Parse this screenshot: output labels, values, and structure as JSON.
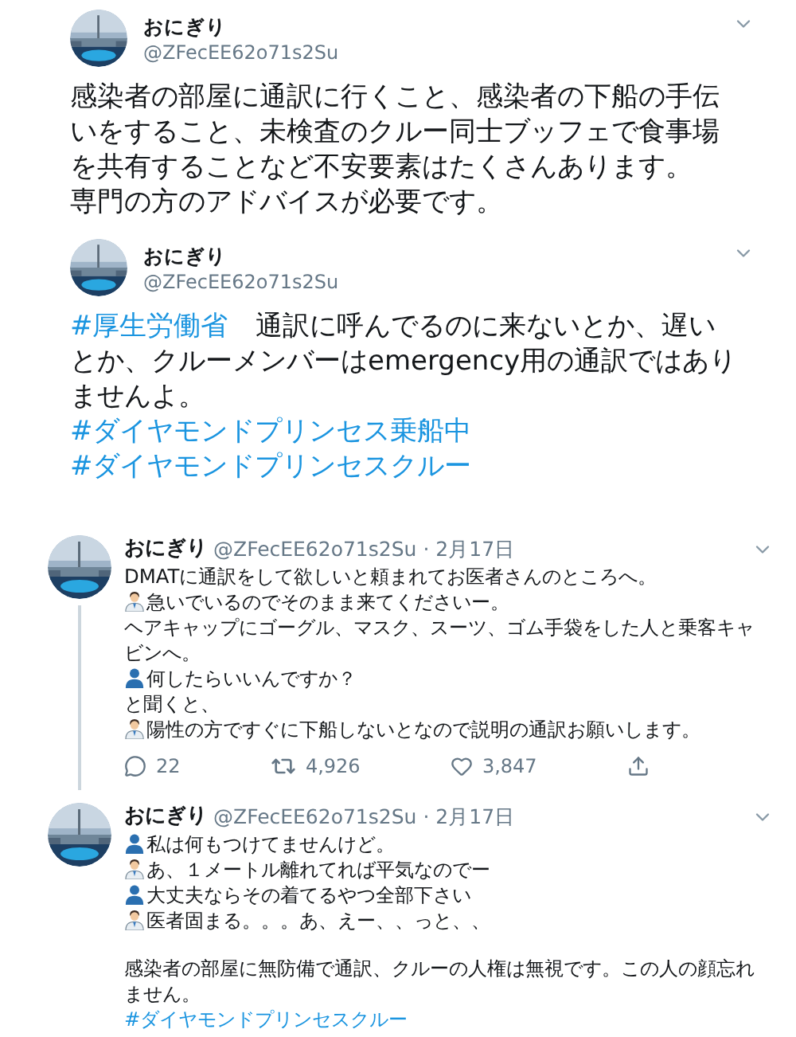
{
  "tweets": [
    {
      "kind": "detail",
      "name": "おにぎり",
      "handle": "@ZFecEE62o71s2Su",
      "paragraphs": [
        [
          {
            "kind": "text",
            "text": "感染者の部屋に通訳に行くこと、感染者の下船の手伝いをすること、未検査のクルー同士ブッフェで食事場を共有することなど不安要素はたくさんあります。"
          }
        ],
        [
          {
            "kind": "text",
            "text": "専門の方のアドバイスが必要です。"
          }
        ]
      ]
    },
    {
      "kind": "detail",
      "name": "おにぎり",
      "handle": "@ZFecEE62o71s2Su",
      "paragraphs": [
        [
          {
            "kind": "hashtag",
            "text": "#厚生労働省"
          },
          {
            "kind": "text",
            "text": "　通訳に呼んでるのに来ないとか、遅いとか、クルーメンバーはemergency用の通訳ではありませんよ。"
          }
        ],
        [
          {
            "kind": "hashtag",
            "text": "#ダイヤモンドプリンセス乗船中"
          }
        ],
        [
          {
            "kind": "hashtag",
            "text": "#ダイヤモンドプリンセスクルー"
          }
        ]
      ]
    },
    {
      "kind": "timeline",
      "name": "おにぎり",
      "handle": "@ZFecEE62o71s2Su",
      "date": "· 2月17日",
      "thread": true,
      "paragraphs": [
        [
          {
            "kind": "text",
            "text": "DMATに通訳をして欲しいと頼まれてお医者さんのところへ。"
          }
        ],
        [
          {
            "kind": "doctor",
            "text": "急いでいるのでそのまま来てくださいー。"
          }
        ],
        [
          {
            "kind": "text",
            "text": "ヘアキャップにゴーグル、マスク、スーツ、ゴム手袋をした人と乗客キャビンへ。"
          }
        ],
        [
          {
            "kind": "person",
            "text": "何したらいいんですか？"
          }
        ],
        [
          {
            "kind": "text",
            "text": "と聞くと、"
          }
        ],
        [
          {
            "kind": "doctor",
            "text": "陽性の方ですぐに下船しないとなので説明の通訳お願いします。"
          }
        ]
      ],
      "stats": {
        "replies": "22",
        "retweets": "4,926",
        "likes": "3,847"
      }
    },
    {
      "kind": "timeline",
      "name": "おにぎり",
      "handle": "@ZFecEE62o71s2Su",
      "date": "· 2月17日",
      "thread": false,
      "paragraphs": [
        [
          {
            "kind": "person",
            "text": "私は何もつけてませんけど。"
          }
        ],
        [
          {
            "kind": "doctor",
            "text": "あ、１メートル離れてれば平気なのでー"
          }
        ],
        [
          {
            "kind": "person",
            "text": "大丈夫ならその着てるやつ全部下さい"
          }
        ],
        [
          {
            "kind": "doctor",
            "text": "医者固まる。。。あ、えー、、っと、、"
          }
        ],
        [
          {
            "kind": "gap",
            "text": "感染者の部屋に無防備で通訳、クルーの人権は無視です。この人の顔忘れません。"
          }
        ],
        [
          {
            "kind": "hashtag",
            "text": "#ダイヤモンドプリンセスクルー"
          }
        ]
      ]
    }
  ]
}
